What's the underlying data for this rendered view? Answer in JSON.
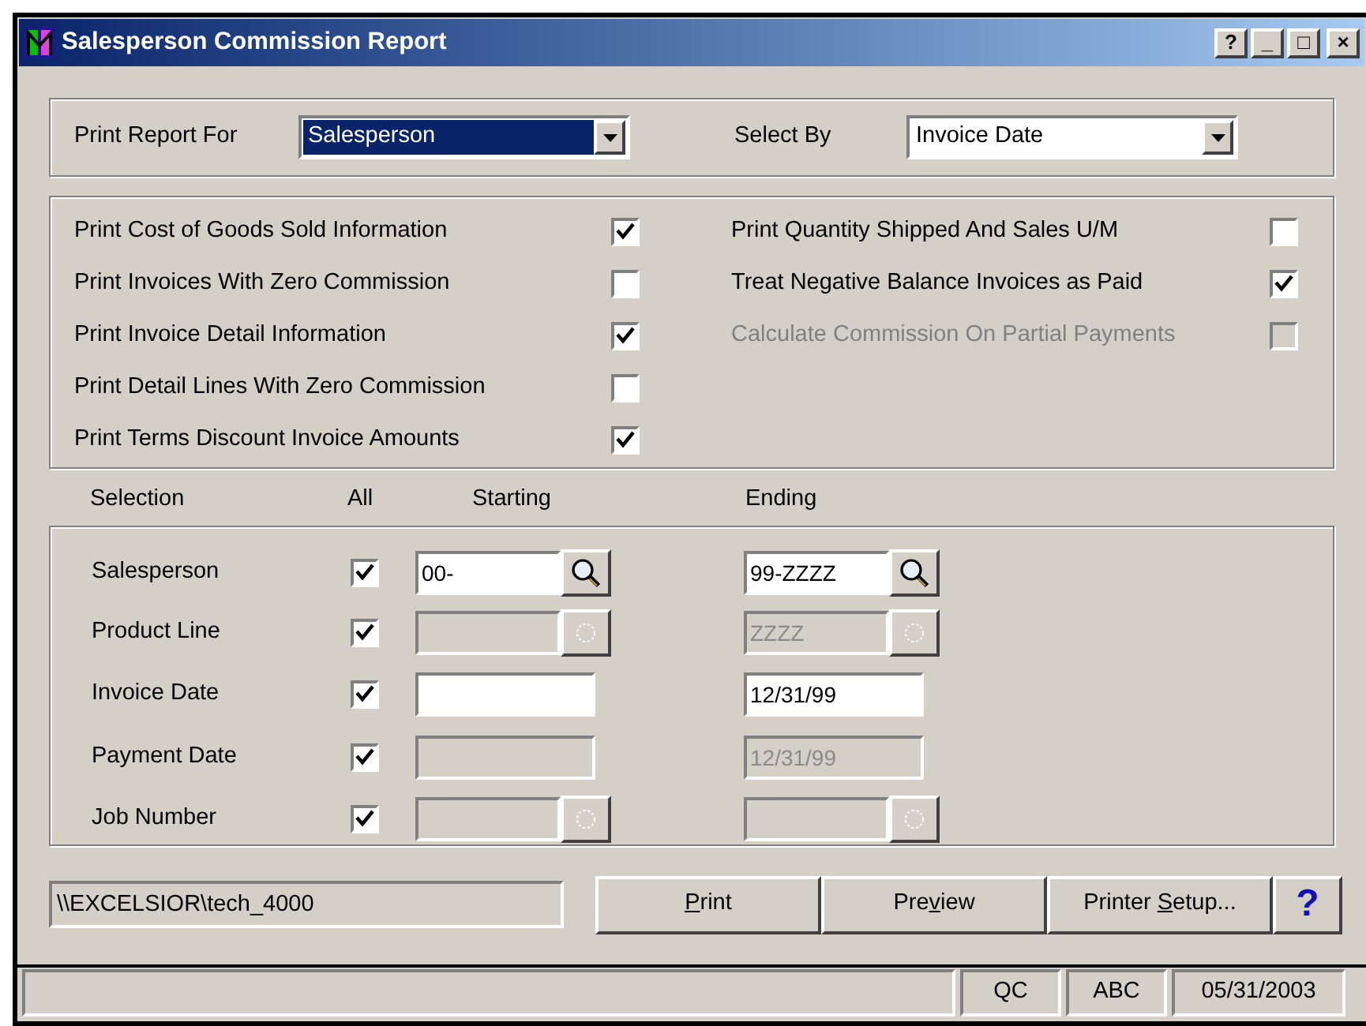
{
  "window": {
    "title": "Salesperson Commission Report",
    "buttons": [
      "?",
      "_",
      "□",
      "×"
    ]
  },
  "report_for": {
    "label": "Print Report For",
    "value": "Salesperson",
    "focused": true
  },
  "select_by": {
    "label": "Select By",
    "value": "Invoice Date",
    "focused": false
  },
  "options": [
    {
      "label": "Print Cost of Goods Sold Information",
      "checked": true,
      "disabled": false
    },
    {
      "label": "Print Invoices With Zero Commission",
      "checked": false,
      "disabled": false
    },
    {
      "label": "Print Invoice Detail Information",
      "checked": true,
      "disabled": false
    },
    {
      "label": "Print Detail Lines With Zero Commission",
      "checked": false,
      "disabled": false
    },
    {
      "label": "Print Terms Discount Invoice Amounts",
      "checked": true,
      "disabled": false
    },
    {
      "label": "Print Quantity Shipped And Sales U/M",
      "checked": false,
      "disabled": false
    },
    {
      "label": "Treat Negative Balance Invoices as Paid",
      "checked": true,
      "disabled": false
    },
    {
      "label": "Calculate Commission On Partial Payments",
      "checked": false,
      "disabled": true
    }
  ],
  "selection": {
    "columns": [
      "Selection",
      "All",
      "Starting",
      "Ending"
    ],
    "rows": [
      {
        "label": "Salesperson",
        "all": true,
        "starting": {
          "value": "00-",
          "disabled": false,
          "lookup": true
        },
        "ending": {
          "value": "99-ZZZZ",
          "disabled": false,
          "lookup": true
        }
      },
      {
        "label": "Product Line",
        "all": true,
        "starting": {
          "disabled": true,
          "lookup": true
        },
        "ending": {
          "value": "ZZZZ",
          "disabled": true,
          "lookup": true
        }
      },
      {
        "label": "Invoice Date",
        "all": true,
        "starting": {
          "disabled": false,
          "lookup": false
        },
        "ending": {
          "value": "12/31/99",
          "disabled": false,
          "lookup": false
        }
      },
      {
        "label": "Payment Date",
        "all": true,
        "starting": {
          "disabled": true,
          "lookup": false
        },
        "ending": {
          "value": "12/31/99",
          "disabled": true,
          "lookup": false
        }
      },
      {
        "label": "Job Number",
        "all": true,
        "starting": {
          "disabled": true,
          "lookup": true
        },
        "ending": {
          "disabled": true,
          "lookup": true
        }
      }
    ]
  },
  "printer": "\\\\EXCELSIOR\\tech_4000",
  "buttons": [
    {
      "mnemonic": "P",
      "after": "rint"
    },
    {
      "before": "Pre",
      "mnemonic": "v",
      "after": "iew"
    },
    {
      "before": "Printer ",
      "mnemonic": "S",
      "after": "etup..."
    }
  ],
  "help_button": "?",
  "status_bar": [
    "QC",
    "ABC",
    "05/31/2003"
  ]
}
